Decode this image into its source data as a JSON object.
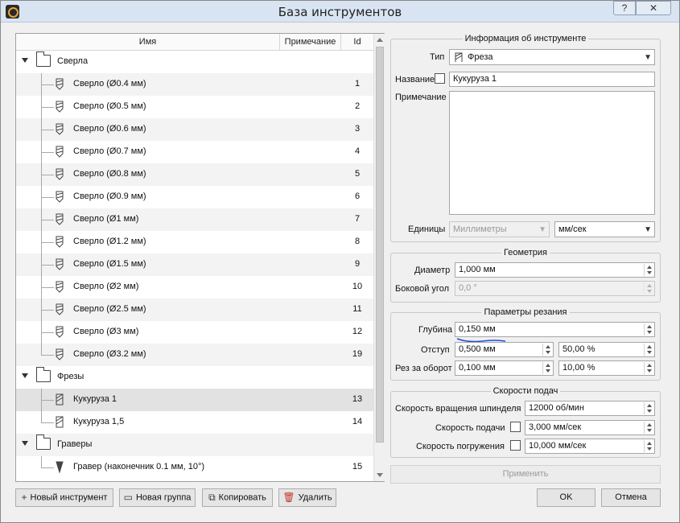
{
  "window": {
    "title": "База инструментов",
    "help_label": "?",
    "close_label": "✕"
  },
  "tree": {
    "headers": {
      "name": "Имя",
      "note": "Примечание",
      "id": "Id"
    },
    "groups": [
      {
        "label": "Сверла",
        "items": [
          {
            "label": "Сверло (Ø0.4 мм)",
            "id": "1"
          },
          {
            "label": "Сверло (Ø0.5 мм)",
            "id": "2"
          },
          {
            "label": "Сверло (Ø0.6 мм)",
            "id": "3"
          },
          {
            "label": "Сверло (Ø0.7 мм)",
            "id": "4"
          },
          {
            "label": "Сверло (Ø0.8 мм)",
            "id": "5"
          },
          {
            "label": "Сверло (Ø0.9 мм)",
            "id": "6"
          },
          {
            "label": "Сверло (Ø1 мм)",
            "id": "7"
          },
          {
            "label": "Сверло (Ø1.2 мм)",
            "id": "8"
          },
          {
            "label": "Сверло (Ø1.5 мм)",
            "id": "9"
          },
          {
            "label": "Сверло (Ø2 мм)",
            "id": "10"
          },
          {
            "label": "Сверло (Ø2.5 мм)",
            "id": "11"
          },
          {
            "label": "Сверло (Ø3 мм)",
            "id": "12"
          },
          {
            "label": "Сверло (Ø3.2 мм)",
            "id": "19"
          }
        ]
      },
      {
        "label": "Фрезы",
        "items": [
          {
            "label": "Кукуруза 1",
            "id": "13"
          },
          {
            "label": "Кукуруза 1,5",
            "id": "14"
          }
        ]
      },
      {
        "label": "Граверы",
        "items": [
          {
            "label": "Гравер (наконечник 0.1 мм, 10°)",
            "id": "15"
          }
        ]
      }
    ]
  },
  "info": {
    "title": "Информация об инструменте",
    "type_label": "Тип",
    "type_value": "Фреза",
    "name_label": "Название",
    "name_value": "Кукуруза 1",
    "note_label": "Примечание",
    "units_label": "Единицы",
    "units_value": "Миллиметры",
    "speed_units_value": "мм/сек"
  },
  "geometry": {
    "title": "Геометрия",
    "diameter_label": "Диаметр",
    "diameter_value": "1,000 мм",
    "side_angle_label": "Боковой угол",
    "side_angle_value": "0,0 °"
  },
  "cutting": {
    "title": "Параметры резания",
    "depth_label": "Глубина",
    "depth_value": "0,150 мм",
    "offset_label": "Отступ",
    "offset_value": "0,500 мм",
    "offset_pct": "50,00 %",
    "per_rev_label": "Рез за оборот",
    "per_rev_value": "0,100 мм",
    "per_rev_pct": "10,00 %"
  },
  "feeds": {
    "title": "Скорости подач",
    "spindle_label": "Скорость вращения шпинделя",
    "spindle_value": "12000 об/мин",
    "feed_label": "Скорость подачи",
    "feed_value": "3,000 мм/сек",
    "plunge_label": "Скорость погружения",
    "plunge_value": "10,000 мм/сек"
  },
  "buttons": {
    "apply": "Применить",
    "new_tool": "Новый инструмент",
    "new_group": "Новая группа",
    "copy": "Копировать",
    "delete": "Удалить",
    "ok": "OK",
    "cancel": "Отмена"
  },
  "colors": {
    "annotation": "#1a4fd6",
    "selected_row": "#e2e2e2"
  }
}
